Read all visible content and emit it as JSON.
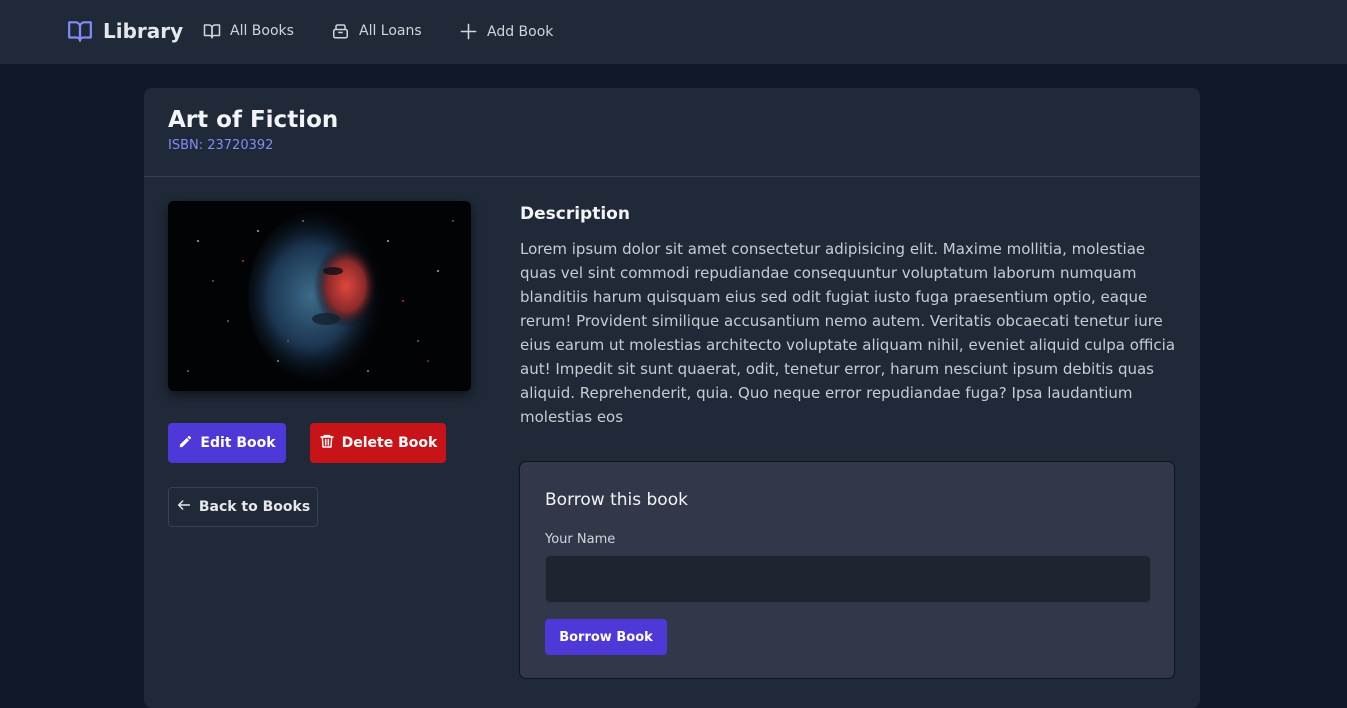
{
  "nav": {
    "brand": "Library",
    "links": [
      {
        "label": "All Books",
        "icon": "book-open-icon"
      },
      {
        "label": "All Loans",
        "icon": "archive-icon"
      },
      {
        "label": "Add Book",
        "icon": "plus-icon"
      }
    ]
  },
  "book": {
    "title": "Art of Fiction",
    "isbn": "ISBN: 23720392",
    "description_heading": "Description",
    "description": "Lorem ipsum dolor sit amet consectetur adipisicing elit. Maxime mollitia, molestiae quas vel sint commodi repudiandae consequuntur voluptatum laborum numquam blanditiis harum quisquam eius sed odit fugiat iusto fuga praesentium optio, eaque rerum! Provident similique accusantium nemo autem. Veritatis obcaecati tenetur iure eius earum ut molestias architecto voluptate aliquam nihil, eveniet aliquid culpa officia aut! Impedit sit sunt quaerat, odit, tenetur error, harum nesciunt ipsum debitis quas aliquid. Reprehenderit, quia. Quo neque error repudiandae fuga? Ipsa laudantium molestias eos"
  },
  "actions": {
    "edit_label": "Edit Book",
    "delete_label": "Delete Book",
    "back_label": "Back to Books"
  },
  "borrow": {
    "title": "Borrow this book",
    "name_label": "Your Name",
    "name_value": "",
    "name_placeholder": "",
    "submit_label": "Borrow Book"
  },
  "colors": {
    "accent": "#4f38d8",
    "danger": "#c81418",
    "link": "#818cf8",
    "background": "#111827",
    "surface": "#1f2937"
  }
}
